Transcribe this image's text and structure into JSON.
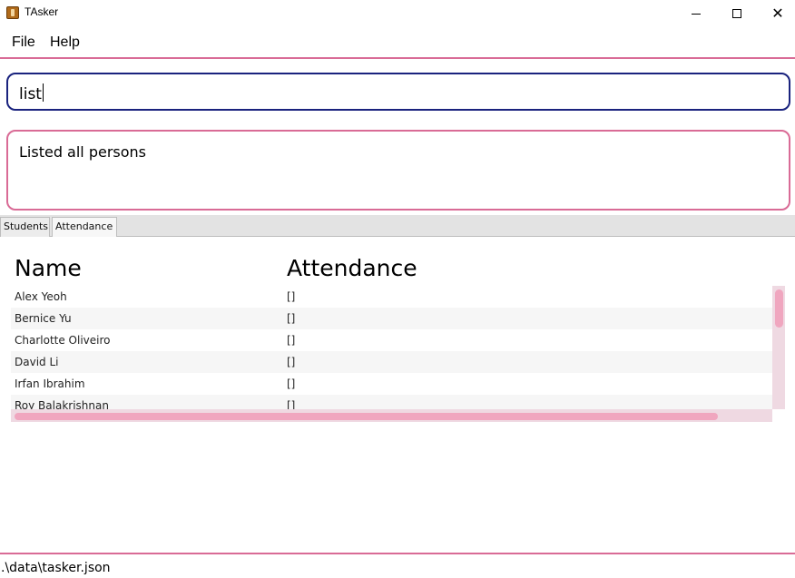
{
  "window": {
    "title": "TAsker",
    "icon": "app-icon",
    "controls": {
      "minimize": "minimize-icon",
      "maximize": "maximize-icon",
      "close": "✕"
    }
  },
  "menu": {
    "items": [
      "File",
      "Help"
    ]
  },
  "command": {
    "value": "list"
  },
  "result": {
    "message": "Listed all persons"
  },
  "tabs": [
    {
      "label": "Students",
      "selected": false
    },
    {
      "label": "Attendance",
      "selected": true
    }
  ],
  "table": {
    "columns": [
      "Name",
      "Attendance"
    ],
    "rows": [
      {
        "name": "Alex Yeoh",
        "attendance": "[]"
      },
      {
        "name": "Bernice Yu",
        "attendance": "[]"
      },
      {
        "name": "Charlotte Oliveiro",
        "attendance": "[]"
      },
      {
        "name": "David Li",
        "attendance": "[]"
      },
      {
        "name": "Irfan Ibrahim",
        "attendance": "[]"
      },
      {
        "name": "Roy Balakrishnan",
        "attendance": "[]"
      }
    ]
  },
  "status": {
    "path": ".\\data\\tasker.json"
  },
  "colors": {
    "accent": "#d96b96",
    "command_border": "#1a237e",
    "scroll_track": "#efd9e2",
    "scroll_thumb": "#f0a6bf"
  }
}
